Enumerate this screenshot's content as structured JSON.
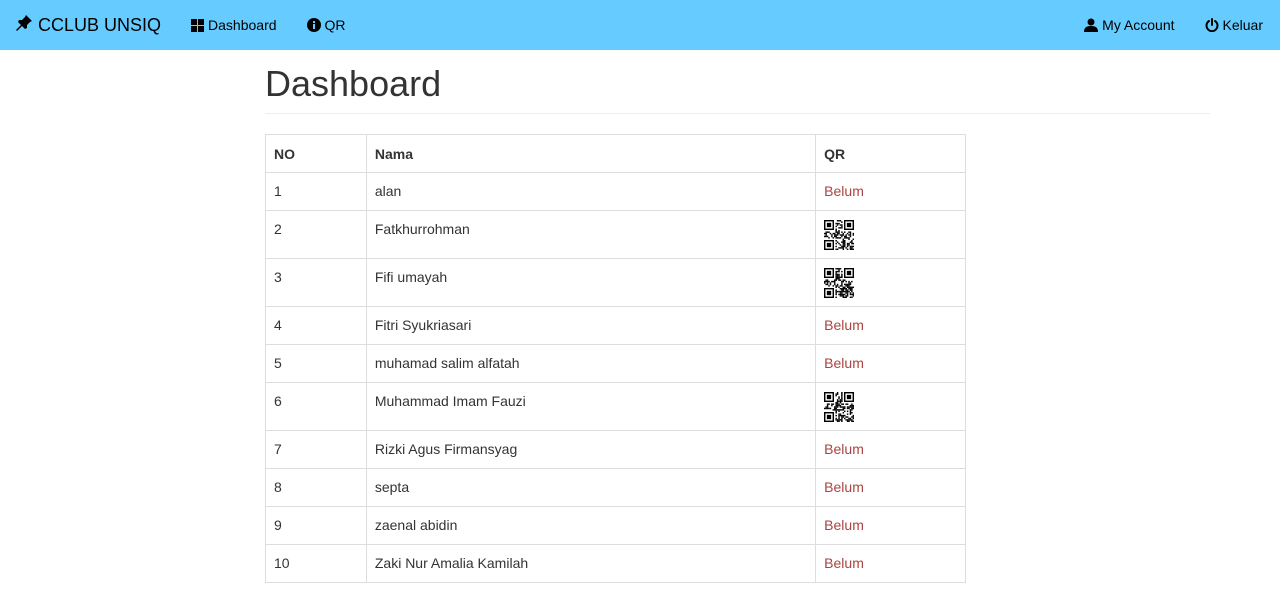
{
  "navbar": {
    "brand": "CCLUB UNSIQ",
    "brand_icon": "pushpin-icon",
    "bg_color": "#66ccff",
    "left_links": [
      {
        "label": "Dashboard",
        "icon": "dashboard-icon"
      },
      {
        "label": "QR",
        "icon": "info-sign-icon"
      }
    ],
    "right_links": [
      {
        "label": "My Account",
        "icon": "user-icon"
      },
      {
        "label": "Keluar",
        "icon": "power-icon"
      }
    ]
  },
  "page": {
    "title": "Dashboard"
  },
  "table": {
    "headers": [
      "NO",
      "Nama",
      "QR"
    ],
    "status_color": "#a94442",
    "rows": [
      {
        "no": "1",
        "nama": "alan",
        "qr": "Belum"
      },
      {
        "no": "2",
        "nama": "Fatkhurrohman",
        "qr": ""
      },
      {
        "no": "3",
        "nama": "Fifi umayah",
        "qr": ""
      },
      {
        "no": "4",
        "nama": "Fitri Syukriasari",
        "qr": "Belum"
      },
      {
        "no": "5",
        "nama": "muhamad salim alfatah",
        "qr": "Belum"
      },
      {
        "no": "6",
        "nama": "Muhammad Imam Fauzi",
        "qr": ""
      },
      {
        "no": "7",
        "nama": "Rizki Agus Firmansyag",
        "qr": "Belum"
      },
      {
        "no": "8",
        "nama": "septa",
        "qr": "Belum"
      },
      {
        "no": "9",
        "nama": "zaenal abidin",
        "qr": "Belum"
      },
      {
        "no": "10",
        "nama": "Zaki Nur Amalia Kamilah",
        "qr": "Belum"
      }
    ]
  }
}
